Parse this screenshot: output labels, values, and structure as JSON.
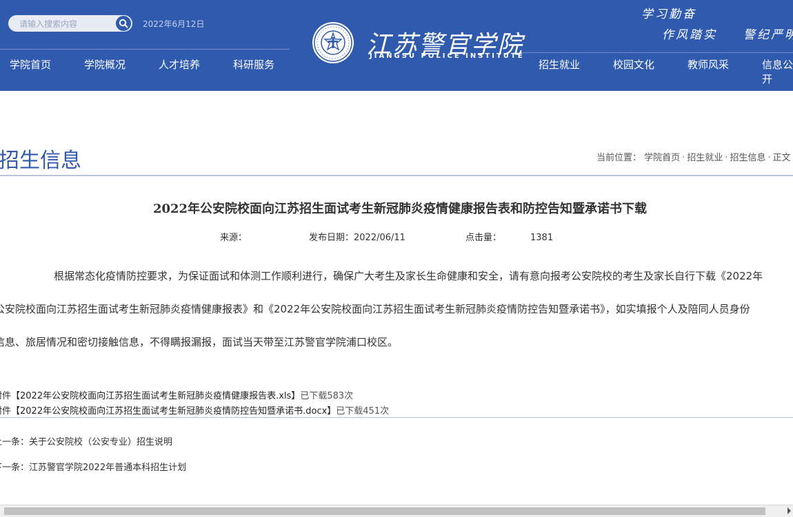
{
  "header": {
    "search_placeholder": "请输入搜索内容",
    "date": "2022年6月12日",
    "logo_cn": "江苏警官学院",
    "logo_en": "JIANGSU POLICE INSTITUTE",
    "motto": [
      "学习勤奋",
      "作风踏实",
      "警纪严明"
    ],
    "nav_left": [
      "学院首页",
      "学院概况",
      "人才培养",
      "科研服务"
    ],
    "nav_right": [
      "招生就业",
      "校园文化",
      "教师风采",
      "信息公开"
    ]
  },
  "section": {
    "title": "招生信息",
    "breadcrumb_label": "当前位置：",
    "breadcrumb": [
      "学院首页",
      "招生就业",
      "招生信息",
      "正文"
    ]
  },
  "article": {
    "title": "2022年公安院校面向江苏招生面试考生新冠肺炎疫情健康报告表和防控告知暨承诺书下载",
    "source_label": "来源：",
    "source": "",
    "date_label": "发布日期：",
    "date": "2022/06/11",
    "views_label": "点击量：",
    "views": "1381",
    "paragraph_lines": [
      "根据常态化疫情防控要求，为保证面试和体测工作顺利进行，确保广大考生及家长生命健康和安全，请有意向报考公安院校的考生及家长自行下载《2022年",
      "公安院校面向江苏招生面试考生新冠肺炎疫情健康报表》和《2022年公安院校面向江苏招生面试考生新冠肺炎疫情防控告知暨承诺书》，如实填报个人及陪同人员身份",
      "信息、旅居情况和密切接触信息，不得瞒报漏报，面试当天带至江苏警官学院浦口校区。"
    ],
    "attachments": [
      {
        "prefix": "附件",
        "name": "【2022年公安院校面向江苏招生面试考生新冠肺炎疫情健康报告表.xls】",
        "count": "已下载583次"
      },
      {
        "prefix": "附件",
        "name": "【2022年公安院校面向江苏招生面试考生新冠肺炎疫情防控告知暨承诺书.docx】",
        "count": "已下载451次"
      }
    ],
    "prev_label": "上一条：",
    "prev": "关于公安院校（公安专业）招生说明",
    "next_label": "下一条：",
    "next": "江苏警官学院2022年普通本科招生计划"
  },
  "colors": {
    "brand": "#2f5aad",
    "rule": "#b8c4dc"
  }
}
